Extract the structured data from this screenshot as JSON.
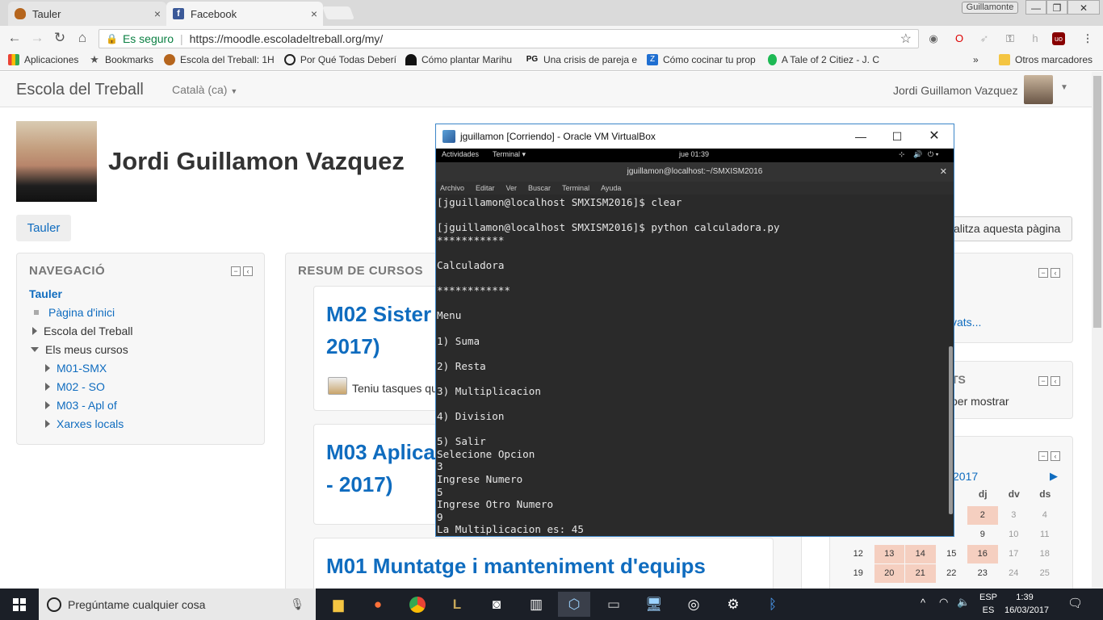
{
  "browser": {
    "tabs": [
      {
        "title": "Tauler",
        "close": "×"
      },
      {
        "title": "Facebook",
        "close": "×"
      }
    ],
    "profile": "Guillamonte",
    "secure_label": "Es seguro",
    "url": "https://moodle.escoladeltreball.org/my/",
    "bookmarks": [
      "Aplicaciones",
      "Bookmarks",
      "Escola del Treball: 1H",
      "Por Qué Todas Deberí",
      "Cómo plantar Marihu",
      "Una crisis de pareja e",
      "Cómo cocinar tu prop",
      "A Tale of 2 Citiez - J. C"
    ],
    "bookmarks_more": "»",
    "other_bookmarks": "Otros marcadores"
  },
  "moodle": {
    "brand": "Escola del Treball",
    "language": "Català (ca)",
    "user_name": "Jordi Guillamon Vazquez",
    "page_heading": "Jordi Guillamon Vazquez",
    "dashboard_button": "Tauler",
    "customise_button": "alitza aquesta pàgina",
    "nav_title": "NAVEGACIÓ",
    "nav_dashboard": "Tauler",
    "nav_site_home": "Pàgina d'inici",
    "nav_site": "Escola del Treball",
    "nav_my_courses": "Els meus cursos",
    "nav_courses": [
      "M01-SMX",
      "M02 - SO",
      "M03 - Apl of",
      "Xarxes locals"
    ],
    "courses_title": "RESUM DE CURSOS",
    "course1_line1": "M02 Sister",
    "course1_line2": "2017)",
    "course1_note": "Teniu tasques qu",
    "course2_line1": "M03 Aplica",
    "course2_line2": "- 2017)",
    "course3_title": "M01 Muntatge i manteniment d'equips",
    "right_link": "vats...",
    "right_block_title": "TS",
    "right_block_text": "per mostrar",
    "calendar": {
      "month_fragment": "2017",
      "next": "▶",
      "day_headers": [
        "c",
        "dj",
        "dv",
        "ds"
      ],
      "rows": [
        [
          "",
          "",
          "",
          "",
          "2",
          "3",
          "4"
        ],
        [
          "",
          "",
          "",
          "",
          "9",
          "10",
          "11"
        ],
        [
          "12",
          "13",
          "14",
          "15",
          "16",
          "17",
          "18"
        ],
        [
          "19",
          "20",
          "21",
          "22",
          "23",
          "24",
          "25"
        ]
      ]
    }
  },
  "vbox": {
    "title": "jguillamon [Corriendo] - Oracle VM VirtualBox",
    "activities": "Actividades",
    "terminal_menu": "Terminal ▾",
    "clock": "jue 01:39",
    "terminal_title": "jguillamon@localhost:~/SMXISM2016",
    "menu": [
      "Archivo",
      "Editar",
      "Ver",
      "Buscar",
      "Terminal",
      "Ayuda"
    ],
    "terminal_output": "[jguillamon@localhost SMXISM2016]$ clear\n\n[jguillamon@localhost SMXISM2016]$ python calculadora.py\n***********\n\nCalculadora\n\n************\n\nMenu\n\n1) Suma\n\n2) Resta\n\n3) Multiplicacion\n\n4) Division\n\n5) Salir\nSelecione Opcion\n3\nIngrese Numero\n5\nIngrese Otro Numero\n9\nLa Multiplicacion es: 45"
  },
  "taskbar": {
    "search_placeholder": "Pregúntame cualquier cosa",
    "lang_top": "ESP",
    "lang_bottom": "ES",
    "time": "1:39",
    "date": "16/03/2017"
  }
}
